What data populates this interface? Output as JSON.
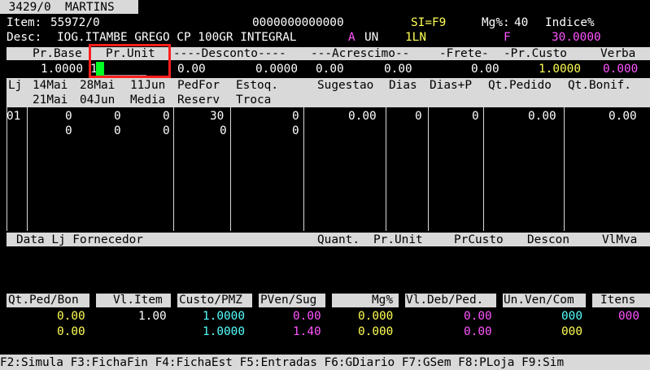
{
  "header": {
    "tab": " 3429/0  MARTINS "
  },
  "item": {
    "item_label": "Item:",
    "item_value": "55972/0",
    "code": "0000000000000",
    "si": "SI=F9",
    "mg_label": "Mg%:",
    "mg_value": "40",
    "indice_label": "Indice%",
    "desc_label": "Desc:",
    "desc_value": "IOG.ITAMBE GREGO CP 100GR INTEGRAL",
    "a": "A",
    "un": "UN",
    "ln": "1LN",
    "f": "F",
    "indice_value": "30.0000"
  },
  "price_header": {
    "pr_base": "Pr.Base",
    "pr_unit": "Pr.Unit",
    "desconto": "----Desconto----",
    "acrescimo": "---Acrescimo--",
    "frete": "-Frete-",
    "pr_custo": "-Pr.Custo",
    "verba": "Verba"
  },
  "price_values": {
    "pr_base": "1.0000",
    "pr_unit_input": "1",
    "pr_unit_blank": "______",
    "desc1": "0.00",
    "desc2": "0.0000",
    "acr1": "0.00",
    "acr2": "0.00",
    "frete": "0.00",
    "pr_custo": "1.0000",
    "verba": "0.000"
  },
  "grid_headers": {
    "row1": [
      "Lj",
      "14Mai",
      "28Mai",
      "11Jun",
      "PedFor",
      "Estoq.",
      "Sugestao",
      "Dias",
      "Dias+P",
      "Qt.Pedido",
      "Qt.Bonif."
    ],
    "row2": [
      "21Mai",
      "04Jun",
      "Media",
      "Reserv",
      "Troca"
    ]
  },
  "grid_rows": {
    "row1": [
      "01",
      "0",
      "0",
      "0",
      "30",
      "0",
      "0.00",
      "0",
      "0",
      "0.00",
      "0.00"
    ],
    "row2": [
      "0",
      "0",
      "0",
      "0",
      "0"
    ]
  },
  "lower_header": {
    "data_lj_fornecedor": "Data Lj Fornecedor",
    "quant": "Quant.",
    "pr_unit": "Pr.Unit",
    "pr_custo": "PrCusto",
    "descon": "Descon",
    "vlmva": "VlMva"
  },
  "summary": {
    "headers": [
      "Qt.Ped/Bon",
      "Vl.Item",
      "Custo/PMZ",
      "PVen/Sug",
      "Mg%",
      "Vl.Deb/Ped.",
      "Un.Ven/Com",
      "Itens"
    ],
    "row1": [
      "0.00",
      "1.00",
      "1.0000",
      "0.00",
      "0.000",
      "0.00",
      "000",
      "000"
    ],
    "row2": [
      "0.00",
      "",
      "1.0000",
      "1.40",
      "0.000",
      "0.00",
      "000",
      ""
    ]
  },
  "function_keys": "F2:Simula F3:FichaFin F4:FichaEst F5:Entradas F6:GDiario F7:GSem F8:PLoja F9:Sim",
  "colors": {
    "background": "#000000",
    "bar": "#d9d9d9",
    "yellow": "#ffff55",
    "magenta": "#ff55ff",
    "cyan": "#55ffff",
    "highlight_box": "#ff1f1f",
    "cursor": "#00ff22"
  }
}
